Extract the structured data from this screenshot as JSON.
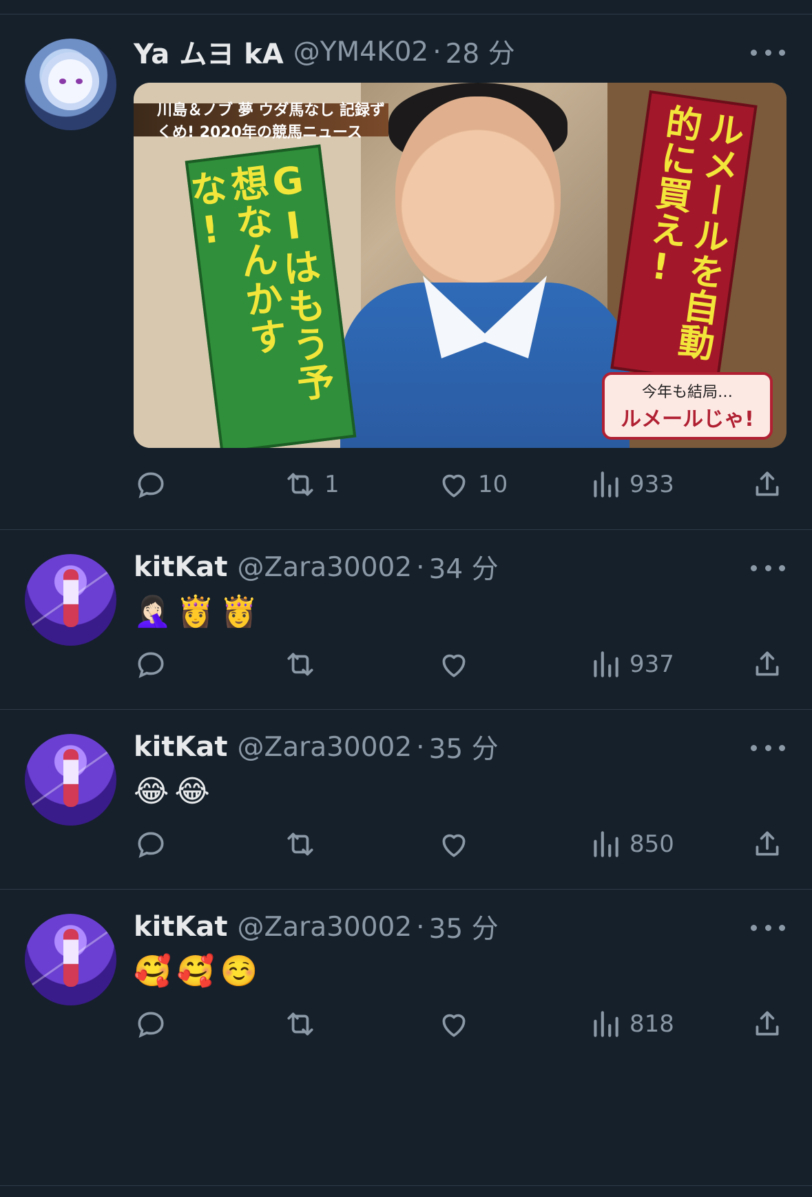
{
  "tweets": [
    {
      "name": "Ya ムヨ kA",
      "handle": "@YM4K02",
      "time": "28 分",
      "emoji": [],
      "media": {
        "banner": "川島＆ノブ 夢 ウダ馬なし 記録ずくめ! 2020年の競馬ニュース",
        "green_text": "GIはもう予想なんかすな!",
        "red_text": "ルメールを自動的に買え!",
        "tag_small": "今年も結局…",
        "tag_big": "ルメールじゃ!"
      },
      "retweets": "1",
      "likes": "10",
      "views": "933"
    },
    {
      "name": "kitKat",
      "handle": "@Zara30002",
      "time": "34 分",
      "emoji": [
        "🤦🏻‍♀️",
        "👸",
        "👸"
      ],
      "retweets": "",
      "likes": "",
      "views": "937"
    },
    {
      "name": "kitKat",
      "handle": "@Zara30002",
      "time": "35 分",
      "emoji": [
        "😂",
        "😂"
      ],
      "retweets": "",
      "likes": "",
      "views": "850"
    },
    {
      "name": "kitKat",
      "handle": "@Zara30002",
      "time": "35 分",
      "emoji": [
        "🥰",
        "🥰",
        "☺️"
      ],
      "retweets": "",
      "likes": "",
      "views": "818"
    }
  ],
  "icons": {
    "reply": "reply-icon",
    "retweet": "retweet-icon",
    "like": "heart-icon",
    "views": "views-icon",
    "share": "share-icon"
  },
  "colors": {
    "background": "#15202b",
    "text": "#e7e9ea",
    "muted": "#8b98a5",
    "divider": "#2f3b47"
  }
}
